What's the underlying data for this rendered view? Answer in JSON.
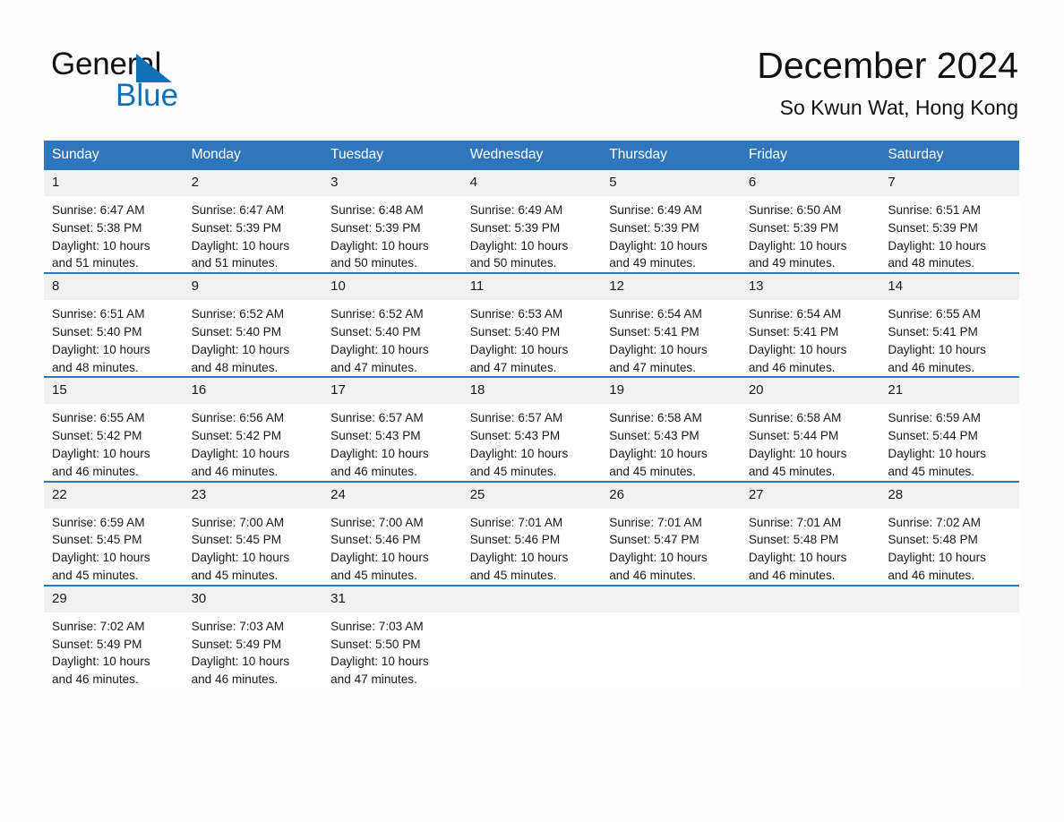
{
  "brand": {
    "name_part1": "General",
    "name_part2": "Blue",
    "accent_color": "#1070b8"
  },
  "header": {
    "title": "December 2024",
    "subtitle": "So Kwun Wat, Hong Kong"
  },
  "calendar": {
    "header_color": "#2f76bc",
    "weekday_headers": [
      "Sunday",
      "Monday",
      "Tuesday",
      "Wednesday",
      "Thursday",
      "Friday",
      "Saturday"
    ],
    "weeks": [
      [
        {
          "day": "1",
          "sunrise": "Sunrise: 6:47 AM",
          "sunset": "Sunset: 5:38 PM",
          "daylight_line1": "Daylight: 10 hours",
          "daylight_line2": "and 51 minutes."
        },
        {
          "day": "2",
          "sunrise": "Sunrise: 6:47 AM",
          "sunset": "Sunset: 5:39 PM",
          "daylight_line1": "Daylight: 10 hours",
          "daylight_line2": "and 51 minutes."
        },
        {
          "day": "3",
          "sunrise": "Sunrise: 6:48 AM",
          "sunset": "Sunset: 5:39 PM",
          "daylight_line1": "Daylight: 10 hours",
          "daylight_line2": "and 50 minutes."
        },
        {
          "day": "4",
          "sunrise": "Sunrise: 6:49 AM",
          "sunset": "Sunset: 5:39 PM",
          "daylight_line1": "Daylight: 10 hours",
          "daylight_line2": "and 50 minutes."
        },
        {
          "day": "5",
          "sunrise": "Sunrise: 6:49 AM",
          "sunset": "Sunset: 5:39 PM",
          "daylight_line1": "Daylight: 10 hours",
          "daylight_line2": "and 49 minutes."
        },
        {
          "day": "6",
          "sunrise": "Sunrise: 6:50 AM",
          "sunset": "Sunset: 5:39 PM",
          "daylight_line1": "Daylight: 10 hours",
          "daylight_line2": "and 49 minutes."
        },
        {
          "day": "7",
          "sunrise": "Sunrise: 6:51 AM",
          "sunset": "Sunset: 5:39 PM",
          "daylight_line1": "Daylight: 10 hours",
          "daylight_line2": "and 48 minutes."
        }
      ],
      [
        {
          "day": "8",
          "sunrise": "Sunrise: 6:51 AM",
          "sunset": "Sunset: 5:40 PM",
          "daylight_line1": "Daylight: 10 hours",
          "daylight_line2": "and 48 minutes."
        },
        {
          "day": "9",
          "sunrise": "Sunrise: 6:52 AM",
          "sunset": "Sunset: 5:40 PM",
          "daylight_line1": "Daylight: 10 hours",
          "daylight_line2": "and 48 minutes."
        },
        {
          "day": "10",
          "sunrise": "Sunrise: 6:52 AM",
          "sunset": "Sunset: 5:40 PM",
          "daylight_line1": "Daylight: 10 hours",
          "daylight_line2": "and 47 minutes."
        },
        {
          "day": "11",
          "sunrise": "Sunrise: 6:53 AM",
          "sunset": "Sunset: 5:40 PM",
          "daylight_line1": "Daylight: 10 hours",
          "daylight_line2": "and 47 minutes."
        },
        {
          "day": "12",
          "sunrise": "Sunrise: 6:54 AM",
          "sunset": "Sunset: 5:41 PM",
          "daylight_line1": "Daylight: 10 hours",
          "daylight_line2": "and 47 minutes."
        },
        {
          "day": "13",
          "sunrise": "Sunrise: 6:54 AM",
          "sunset": "Sunset: 5:41 PM",
          "daylight_line1": "Daylight: 10 hours",
          "daylight_line2": "and 46 minutes."
        },
        {
          "day": "14",
          "sunrise": "Sunrise: 6:55 AM",
          "sunset": "Sunset: 5:41 PM",
          "daylight_line1": "Daylight: 10 hours",
          "daylight_line2": "and 46 minutes."
        }
      ],
      [
        {
          "day": "15",
          "sunrise": "Sunrise: 6:55 AM",
          "sunset": "Sunset: 5:42 PM",
          "daylight_line1": "Daylight: 10 hours",
          "daylight_line2": "and 46 minutes."
        },
        {
          "day": "16",
          "sunrise": "Sunrise: 6:56 AM",
          "sunset": "Sunset: 5:42 PM",
          "daylight_line1": "Daylight: 10 hours",
          "daylight_line2": "and 46 minutes."
        },
        {
          "day": "17",
          "sunrise": "Sunrise: 6:57 AM",
          "sunset": "Sunset: 5:43 PM",
          "daylight_line1": "Daylight: 10 hours",
          "daylight_line2": "and 46 minutes."
        },
        {
          "day": "18",
          "sunrise": "Sunrise: 6:57 AM",
          "sunset": "Sunset: 5:43 PM",
          "daylight_line1": "Daylight: 10 hours",
          "daylight_line2": "and 45 minutes."
        },
        {
          "day": "19",
          "sunrise": "Sunrise: 6:58 AM",
          "sunset": "Sunset: 5:43 PM",
          "daylight_line1": "Daylight: 10 hours",
          "daylight_line2": "and 45 minutes."
        },
        {
          "day": "20",
          "sunrise": "Sunrise: 6:58 AM",
          "sunset": "Sunset: 5:44 PM",
          "daylight_line1": "Daylight: 10 hours",
          "daylight_line2": "and 45 minutes."
        },
        {
          "day": "21",
          "sunrise": "Sunrise: 6:59 AM",
          "sunset": "Sunset: 5:44 PM",
          "daylight_line1": "Daylight: 10 hours",
          "daylight_line2": "and 45 minutes."
        }
      ],
      [
        {
          "day": "22",
          "sunrise": "Sunrise: 6:59 AM",
          "sunset": "Sunset: 5:45 PM",
          "daylight_line1": "Daylight: 10 hours",
          "daylight_line2": "and 45 minutes."
        },
        {
          "day": "23",
          "sunrise": "Sunrise: 7:00 AM",
          "sunset": "Sunset: 5:45 PM",
          "daylight_line1": "Daylight: 10 hours",
          "daylight_line2": "and 45 minutes."
        },
        {
          "day": "24",
          "sunrise": "Sunrise: 7:00 AM",
          "sunset": "Sunset: 5:46 PM",
          "daylight_line1": "Daylight: 10 hours",
          "daylight_line2": "and 45 minutes."
        },
        {
          "day": "25",
          "sunrise": "Sunrise: 7:01 AM",
          "sunset": "Sunset: 5:46 PM",
          "daylight_line1": "Daylight: 10 hours",
          "daylight_line2": "and 45 minutes."
        },
        {
          "day": "26",
          "sunrise": "Sunrise: 7:01 AM",
          "sunset": "Sunset: 5:47 PM",
          "daylight_line1": "Daylight: 10 hours",
          "daylight_line2": "and 46 minutes."
        },
        {
          "day": "27",
          "sunrise": "Sunrise: 7:01 AM",
          "sunset": "Sunset: 5:48 PM",
          "daylight_line1": "Daylight: 10 hours",
          "daylight_line2": "and 46 minutes."
        },
        {
          "day": "28",
          "sunrise": "Sunrise: 7:02 AM",
          "sunset": "Sunset: 5:48 PM",
          "daylight_line1": "Daylight: 10 hours",
          "daylight_line2": "and 46 minutes."
        }
      ],
      [
        {
          "day": "29",
          "sunrise": "Sunrise: 7:02 AM",
          "sunset": "Sunset: 5:49 PM",
          "daylight_line1": "Daylight: 10 hours",
          "daylight_line2": "and 46 minutes."
        },
        {
          "day": "30",
          "sunrise": "Sunrise: 7:03 AM",
          "sunset": "Sunset: 5:49 PM",
          "daylight_line1": "Daylight: 10 hours",
          "daylight_line2": "and 46 minutes."
        },
        {
          "day": "31",
          "sunrise": "Sunrise: 7:03 AM",
          "sunset": "Sunset: 5:50 PM",
          "daylight_line1": "Daylight: 10 hours",
          "daylight_line2": "and 47 minutes."
        },
        {
          "day": "",
          "sunrise": "",
          "sunset": "",
          "daylight_line1": "",
          "daylight_line2": ""
        },
        {
          "day": "",
          "sunrise": "",
          "sunset": "",
          "daylight_line1": "",
          "daylight_line2": ""
        },
        {
          "day": "",
          "sunrise": "",
          "sunset": "",
          "daylight_line1": "",
          "daylight_line2": ""
        },
        {
          "day": "",
          "sunrise": "",
          "sunset": "",
          "daylight_line1": "",
          "daylight_line2": ""
        }
      ]
    ]
  }
}
